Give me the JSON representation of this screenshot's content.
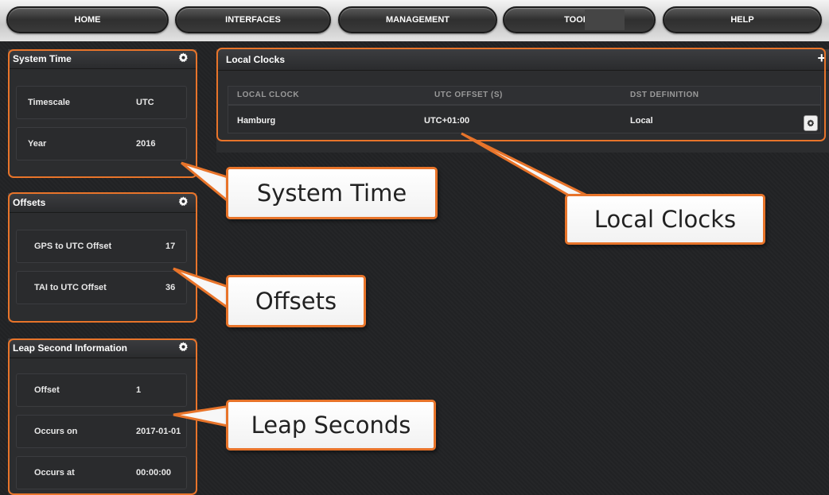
{
  "nav": {
    "home": "HOME",
    "interfaces": "INTERFACES",
    "management": "MANAGEMENT",
    "tools": "TOOLS",
    "help": "HELP"
  },
  "system_time": {
    "title": "System Time",
    "rows": [
      {
        "label": "Timescale",
        "value": "UTC"
      },
      {
        "label": "Year",
        "value": "2016"
      }
    ]
  },
  "offsets": {
    "title": "Offsets",
    "rows": [
      {
        "label": "GPS to UTC Offset",
        "value": "17"
      },
      {
        "label": "TAI to UTC Offset",
        "value": "36"
      }
    ]
  },
  "leap": {
    "title": "Leap Second Information",
    "rows": [
      {
        "label": "Offset",
        "value": "1"
      },
      {
        "label": "Occurs on",
        "value": "2017-01-01"
      },
      {
        "label": "Occurs at",
        "value": "00:00:00"
      }
    ]
  },
  "local_clocks": {
    "title": "Local Clocks",
    "add_icon": "+",
    "columns": [
      "LOCAL CLOCK",
      "UTC OFFSET (S)",
      "DST DEFINITION"
    ],
    "rows": [
      {
        "clock": "Hamburg",
        "offset": "UTC+01:00",
        "dst": "Local"
      }
    ]
  },
  "callouts": {
    "system_time": "System Time",
    "offsets": "Offsets",
    "local_clocks": "Local Clocks",
    "leap_seconds": "Leap Seconds"
  },
  "colors": {
    "accent": "#e8742a",
    "background": "#222325",
    "panel": "#2c2d2f"
  }
}
